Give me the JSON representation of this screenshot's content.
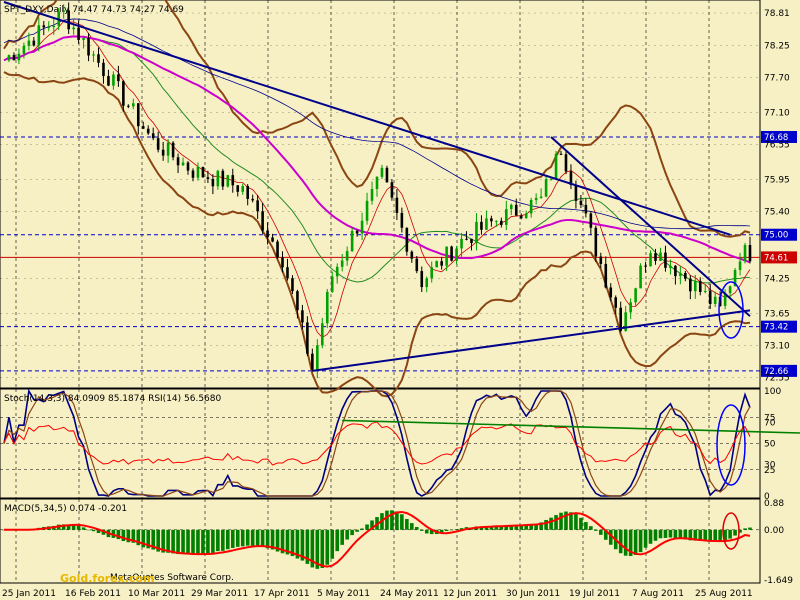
{
  "chart_data": [
    {
      "panel": "price",
      "type": "candlestick",
      "title": "SPT_DXY,Daily",
      "ohlc_header": "74.47 74.73 74.27 74.69",
      "ylim": [
        72.4,
        79.0
      ],
      "y_ticks": [
        78.81,
        78.25,
        77.7,
        77.1,
        76.55,
        75.95,
        75.4,
        74.25,
        73.65,
        73.1,
        72.55
      ],
      "tick_labels": [
        "78.81",
        "78.25",
        "77.70",
        "77.10",
        "76.55",
        "75.95",
        "75.40",
        "74.25",
        "73.65",
        "73.10",
        "72.55"
      ],
      "x_labels": [
        "25 Jan 2011",
        "16 Feb 2011",
        "10 Mar 2011",
        "29 Mar 2011",
        "17 Apr 2011",
        "5 May 2011",
        "24 May 2011",
        "12 Jun 2011",
        "30 Jun 2011",
        "19 Jul 2011",
        "7 Aug 2011",
        "25 Aug 2011"
      ],
      "horizontal_levels": [
        {
          "value": 76.68,
          "label": "76.68",
          "color": "#0000cc",
          "style": "dashed"
        },
        {
          "value": 75.0,
          "label": "75.00",
          "color": "#0000cc",
          "style": "dashed"
        },
        {
          "value": 74.61,
          "label": "74.61",
          "color": "#cc0000",
          "style": "solid"
        },
        {
          "value": 73.42,
          "label": "73.42",
          "color": "#0000cc",
          "style": "dashed"
        },
        {
          "value": 72.66,
          "label": "72.66",
          "color": "#0000cc",
          "style": "dashed"
        }
      ],
      "trendlines": [
        {
          "from": [
            0,
            79.0
          ],
          "to": [
            146,
            75.0
          ],
          "color": "#00008b"
        },
        {
          "from": [
            110,
            76.68
          ],
          "to": [
            150,
            73.6
          ],
          "color": "#00008b"
        },
        {
          "from": [
            62,
            72.66
          ],
          "to": [
            150,
            73.7
          ],
          "color": "#00008b"
        }
      ],
      "series": [
        {
          "name": "",
          "kind": "candles",
          "x": [
            0,
            150
          ],
          "approx_path": [
            [
              0,
              78.0
            ],
            [
              12,
              78.8
            ],
            [
              22,
              77.6
            ],
            [
              30,
              76.6
            ],
            [
              38,
              76.1
            ],
            [
              48,
              75.8
            ],
            [
              56,
              74.6
            ],
            [
              62,
              72.7
            ],
            [
              66,
              74.3
            ],
            [
              76,
              76.0
            ],
            [
              84,
              74.2
            ],
            [
              92,
              74.9
            ],
            [
              100,
              75.3
            ],
            [
              108,
              75.6
            ],
            [
              112,
              76.5
            ],
            [
              118,
              75.0
            ],
            [
              124,
              73.5
            ],
            [
              130,
              74.8
            ],
            [
              138,
              74.2
            ],
            [
              144,
              73.7
            ],
            [
              148,
              74.69
            ]
          ]
        }
      ],
      "last_price": 74.69,
      "colors": {
        "bull": "#00a000",
        "bear": "#000000",
        "bands": "#8b4513",
        "ma_magenta": "#cc00cc",
        "ma_red": "#cc0000"
      }
    },
    {
      "panel": "oscillator",
      "type": "line",
      "title": "Stoch(14,3,3) 84.0909 85.1874 RSI(14) 56.5680",
      "ylim": [
        0,
        100
      ],
      "y_ticks": [
        100,
        75,
        70,
        50,
        30,
        25,
        0
      ],
      "tick_labels": [
        "100",
        "75",
        "70",
        "50",
        "30",
        "25",
        "0"
      ],
      "series": [
        {
          "name": "Stoch(14,3,3)",
          "values_main": 84.0909,
          "values_signal": 85.1874
        },
        {
          "name": "RSI(14)",
          "value": 56.568
        }
      ]
    },
    {
      "panel": "macd",
      "type": "bar",
      "title": "MACD(5,34,5) 0.074 -0.201",
      "ylim": [
        -1.649,
        0.88
      ],
      "y_ticks": [
        0.88,
        0.0,
        -1.649
      ],
      "tick_labels": [
        "0.88",
        "0.00",
        "-1.649"
      ],
      "series": [
        {
          "name": "MACD(5,34,5)",
          "value": 0.074
        },
        {
          "name": "signal",
          "value": -0.201
        }
      ]
    }
  ],
  "copyright": "MetaQuotes Software Corp.",
  "watermark": "Gold.forex.com"
}
